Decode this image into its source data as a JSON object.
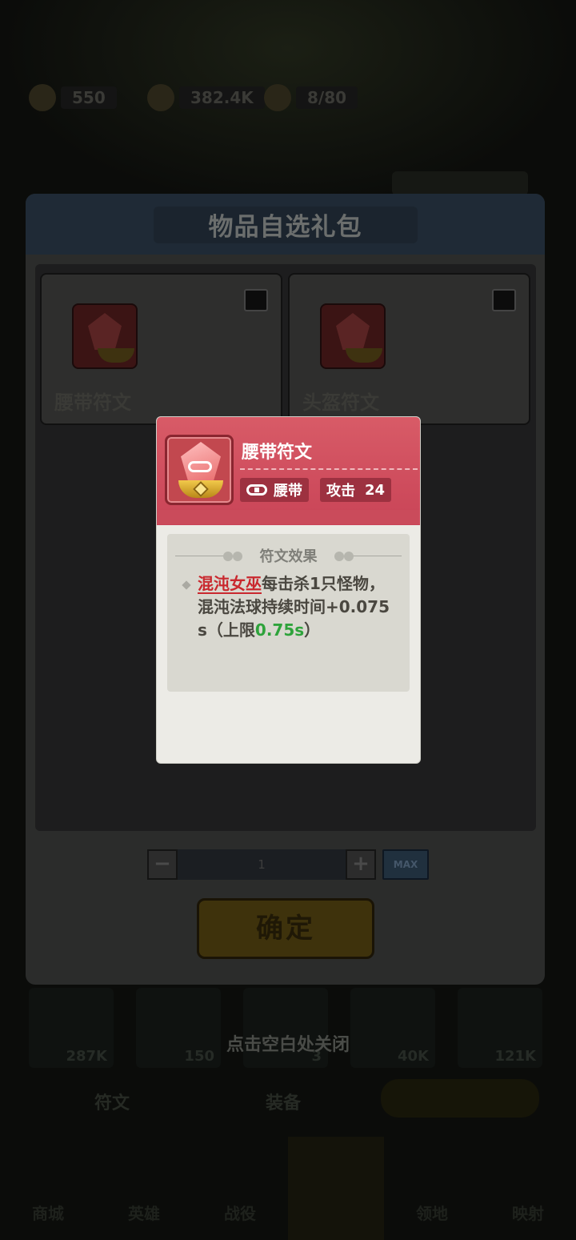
{
  "background": {
    "resources": [
      {
        "icon": "energy-icon",
        "value": "550"
      },
      {
        "icon": "coin-icon",
        "value": "382.4K"
      },
      {
        "icon": "stamina-icon",
        "value": "8/80"
      }
    ],
    "slot_counts": [
      "287K",
      "150",
      "3",
      "40K",
      "121K"
    ],
    "tabs": [
      "符文",
      "装备"
    ],
    "nav_items": [
      "商城",
      "英雄",
      "战役",
      "",
      "领地",
      "映射"
    ]
  },
  "dialog": {
    "title": "物品自选礼包",
    "items": [
      {
        "name": "腰带符文",
        "icon": "belt-rune-icon",
        "selected": false
      },
      {
        "name": "头盔符文",
        "icon": "helmet-rune-icon",
        "selected": false
      }
    ],
    "quantity": {
      "minus": "−",
      "value": "1",
      "plus": "+",
      "max_label": "MAX"
    },
    "confirm_label": "确定",
    "close_hint": "点击空白处关闭"
  },
  "tooltip": {
    "name": "腰带符文",
    "slot_label": "腰带",
    "stat_label": "攻击",
    "stat_value": "24",
    "section_title": "符文效果",
    "desc_hero": "混沌女巫",
    "desc_main": "每击杀1只怪物，混沌法球持续时间+0.075s（上限",
    "desc_cap": "0.75s",
    "desc_end": "）",
    "colors": {
      "header": "#d85b67",
      "hero": "#c9282e",
      "cap": "#2ea33b"
    }
  }
}
